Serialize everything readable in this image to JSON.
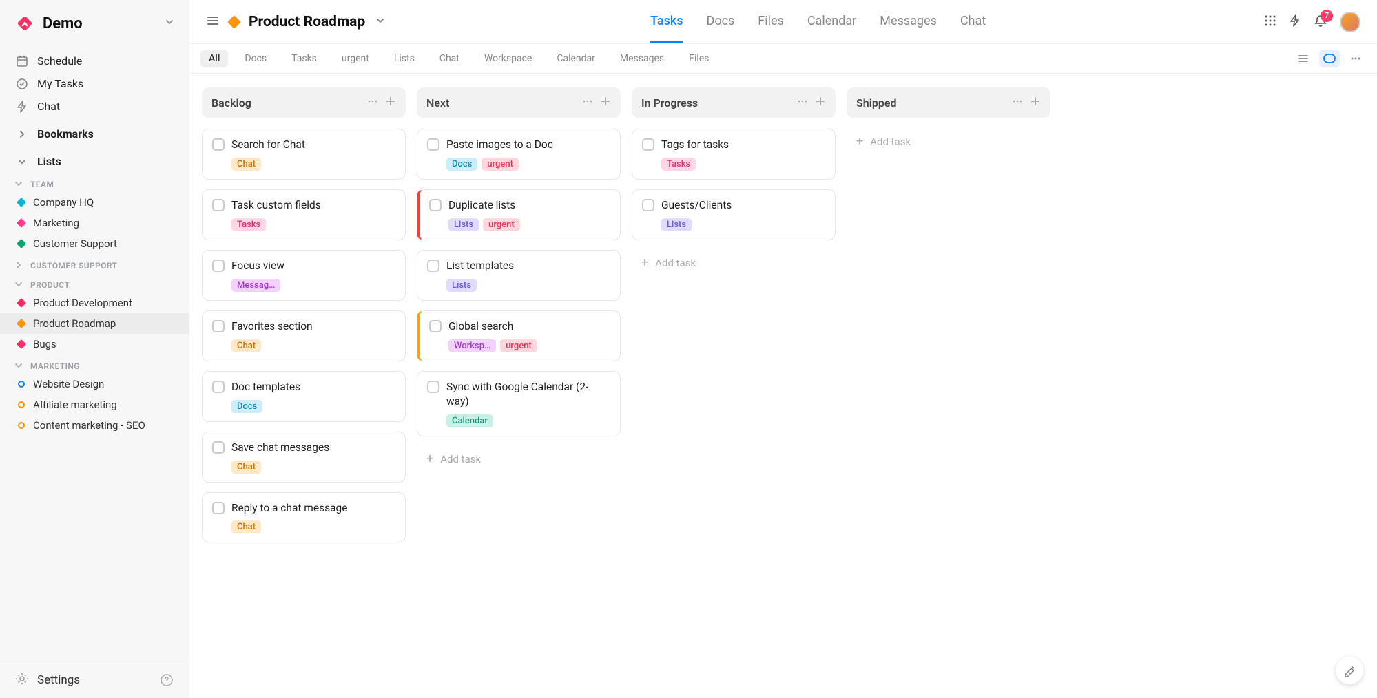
{
  "workspace": {
    "name": "Demo"
  },
  "sidebar": {
    "nav": [
      {
        "label": "Schedule",
        "icon": "calendar"
      },
      {
        "label": "My Tasks",
        "icon": "check-circle"
      },
      {
        "label": "Chat",
        "icon": "bolt"
      }
    ],
    "bookmarks_label": "Bookmarks",
    "lists_label": "Lists",
    "sections": [
      {
        "title": "TEAM",
        "items": [
          {
            "label": "Company HQ",
            "color": "#00b8d4",
            "shape": "diamond"
          },
          {
            "label": "Marketing",
            "color": "#ff3b8d",
            "shape": "diamond"
          },
          {
            "label": "Customer Support",
            "color": "#00a86b",
            "shape": "diamond"
          }
        ]
      },
      {
        "title": "CUSTOMER SUPPORT",
        "collapsed": true,
        "items": []
      },
      {
        "title": "PRODUCT",
        "items": [
          {
            "label": "Product Development",
            "color": "#ff2e63",
            "shape": "diamond"
          },
          {
            "label": "Product Roadmap",
            "color": "#ff9500",
            "shape": "diamond",
            "active": true
          },
          {
            "label": "Bugs",
            "color": "#ff2e63",
            "shape": "diamond"
          }
        ]
      },
      {
        "title": "MARKETING",
        "items": [
          {
            "label": "Website Design",
            "color": "#0a84ff",
            "shape": "circle"
          },
          {
            "label": "Affiliate marketing",
            "color": "#ff9500",
            "shape": "circle"
          },
          {
            "label": "Content marketing - SEO",
            "color": "#ff9500",
            "shape": "circle"
          }
        ]
      }
    ],
    "settings_label": "Settings"
  },
  "header": {
    "page_title": "Product Roadmap",
    "page_color": "#ff9500",
    "tabs": [
      "Tasks",
      "Docs",
      "Files",
      "Calendar",
      "Messages",
      "Chat"
    ],
    "active_tab": "Tasks",
    "notification_count": "7"
  },
  "filters": {
    "chips": [
      "All",
      "Docs",
      "Tasks",
      "urgent",
      "Lists",
      "Chat",
      "Workspace",
      "Calendar",
      "Messages",
      "Files"
    ],
    "active_chip": "All"
  },
  "tag_palette": {
    "Chat": {
      "bg": "#ffe8c6",
      "fg": "#c77400"
    },
    "Tasks": {
      "bg": "#ffd6e7",
      "fg": "#d6336c"
    },
    "Messag…": {
      "bg": "#f3d1ff",
      "fg": "#a23bd1"
    },
    "Docs": {
      "bg": "#cdeef9",
      "fg": "#0a88b5"
    },
    "urgent": {
      "bg": "#ffd6de",
      "fg": "#e6375a"
    },
    "Lists": {
      "bg": "#e2dbff",
      "fg": "#6b5cd6"
    },
    "Worksp…": {
      "bg": "#f3d1ff",
      "fg": "#a23bd1"
    },
    "Calendar": {
      "bg": "#c9f0e6",
      "fg": "#1a9e7a"
    }
  },
  "board": {
    "add_task_label": "Add task",
    "columns": [
      {
        "title": "Backlog",
        "cards": [
          {
            "title": "Search for Chat",
            "tags": [
              "Chat"
            ]
          },
          {
            "title": "Task custom fields",
            "tags": [
              "Tasks"
            ]
          },
          {
            "title": "Focus view",
            "tags": [
              "Messag…"
            ]
          },
          {
            "title": "Favorites section",
            "tags": [
              "Chat"
            ]
          },
          {
            "title": "Doc templates",
            "tags": [
              "Docs"
            ]
          },
          {
            "title": "Save chat messages",
            "tags": [
              "Chat"
            ]
          },
          {
            "title": "Reply to a chat message",
            "tags": [
              "Chat"
            ]
          }
        ],
        "show_add": false
      },
      {
        "title": "Next",
        "cards": [
          {
            "title": "Paste images to a Doc",
            "tags": [
              "Docs",
              "urgent"
            ]
          },
          {
            "title": "Duplicate lists",
            "tags": [
              "Lists",
              "urgent"
            ],
            "flag": "red"
          },
          {
            "title": "List templates",
            "tags": [
              "Lists"
            ]
          },
          {
            "title": "Global search",
            "tags": [
              "Worksp…",
              "urgent"
            ],
            "flag": "orange"
          },
          {
            "title": "Sync with Google Calendar (2-way)",
            "tags": [
              "Calendar"
            ]
          }
        ],
        "show_add": true
      },
      {
        "title": "In Progress",
        "cards": [
          {
            "title": "Tags for tasks",
            "tags": [
              "Tasks"
            ]
          },
          {
            "title": "Guests/Clients",
            "tags": [
              "Lists"
            ]
          }
        ],
        "show_add": true
      },
      {
        "title": "Shipped",
        "cards": [],
        "show_add": true
      }
    ]
  }
}
